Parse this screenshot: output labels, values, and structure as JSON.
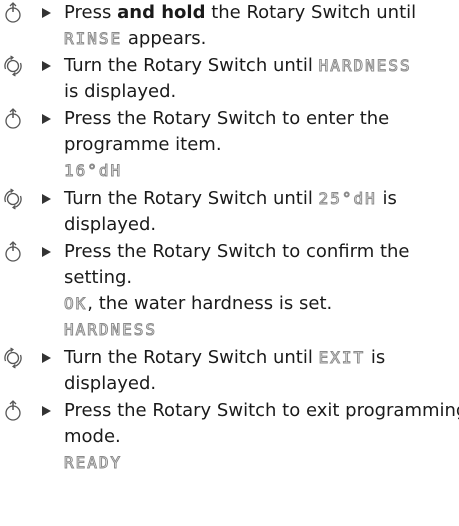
{
  "steps": [
    {
      "icon": "rotary-press-icon",
      "line1_pre": "Press ",
      "line1_bold": "and hold",
      "line1_post": " the Rotary Switch until",
      "line2_lcd": "RINSE",
      "line2_post": " appears."
    },
    {
      "icon": "rotary-turn-icon",
      "line1_pre": "Turn the Rotary Switch until ",
      "line1_lcd": "HARDNESS",
      "line2": "is displayed."
    },
    {
      "icon": "rotary-press-icon",
      "line1": "Press the Rotary Switch to enter the",
      "line2": "programme item.",
      "line3_lcd": "16°dH"
    },
    {
      "icon": "rotary-turn-icon",
      "line1_pre": "Turn the Rotary Switch until ",
      "line1_lcd": "25°dH",
      "line1_post": " is",
      "line2": "displayed."
    },
    {
      "icon": "rotary-press-icon",
      "line1": "Press the Rotary Switch to confirm the",
      "line2": "setting.",
      "line3_lcd": "OK",
      "line3_post": ", the water hardness is set.",
      "line4_lcd": "HARDNESS"
    },
    {
      "icon": "rotary-turn-icon",
      "line1_pre": "Turn the Rotary Switch until ",
      "line1_lcd": "EXIT",
      "line1_post": " is",
      "line2": "displayed."
    },
    {
      "icon": "rotary-press-icon",
      "line1": "Press the Rotary Switch to exit programming",
      "line2": "mode.",
      "line3_lcd": "READY"
    }
  ]
}
